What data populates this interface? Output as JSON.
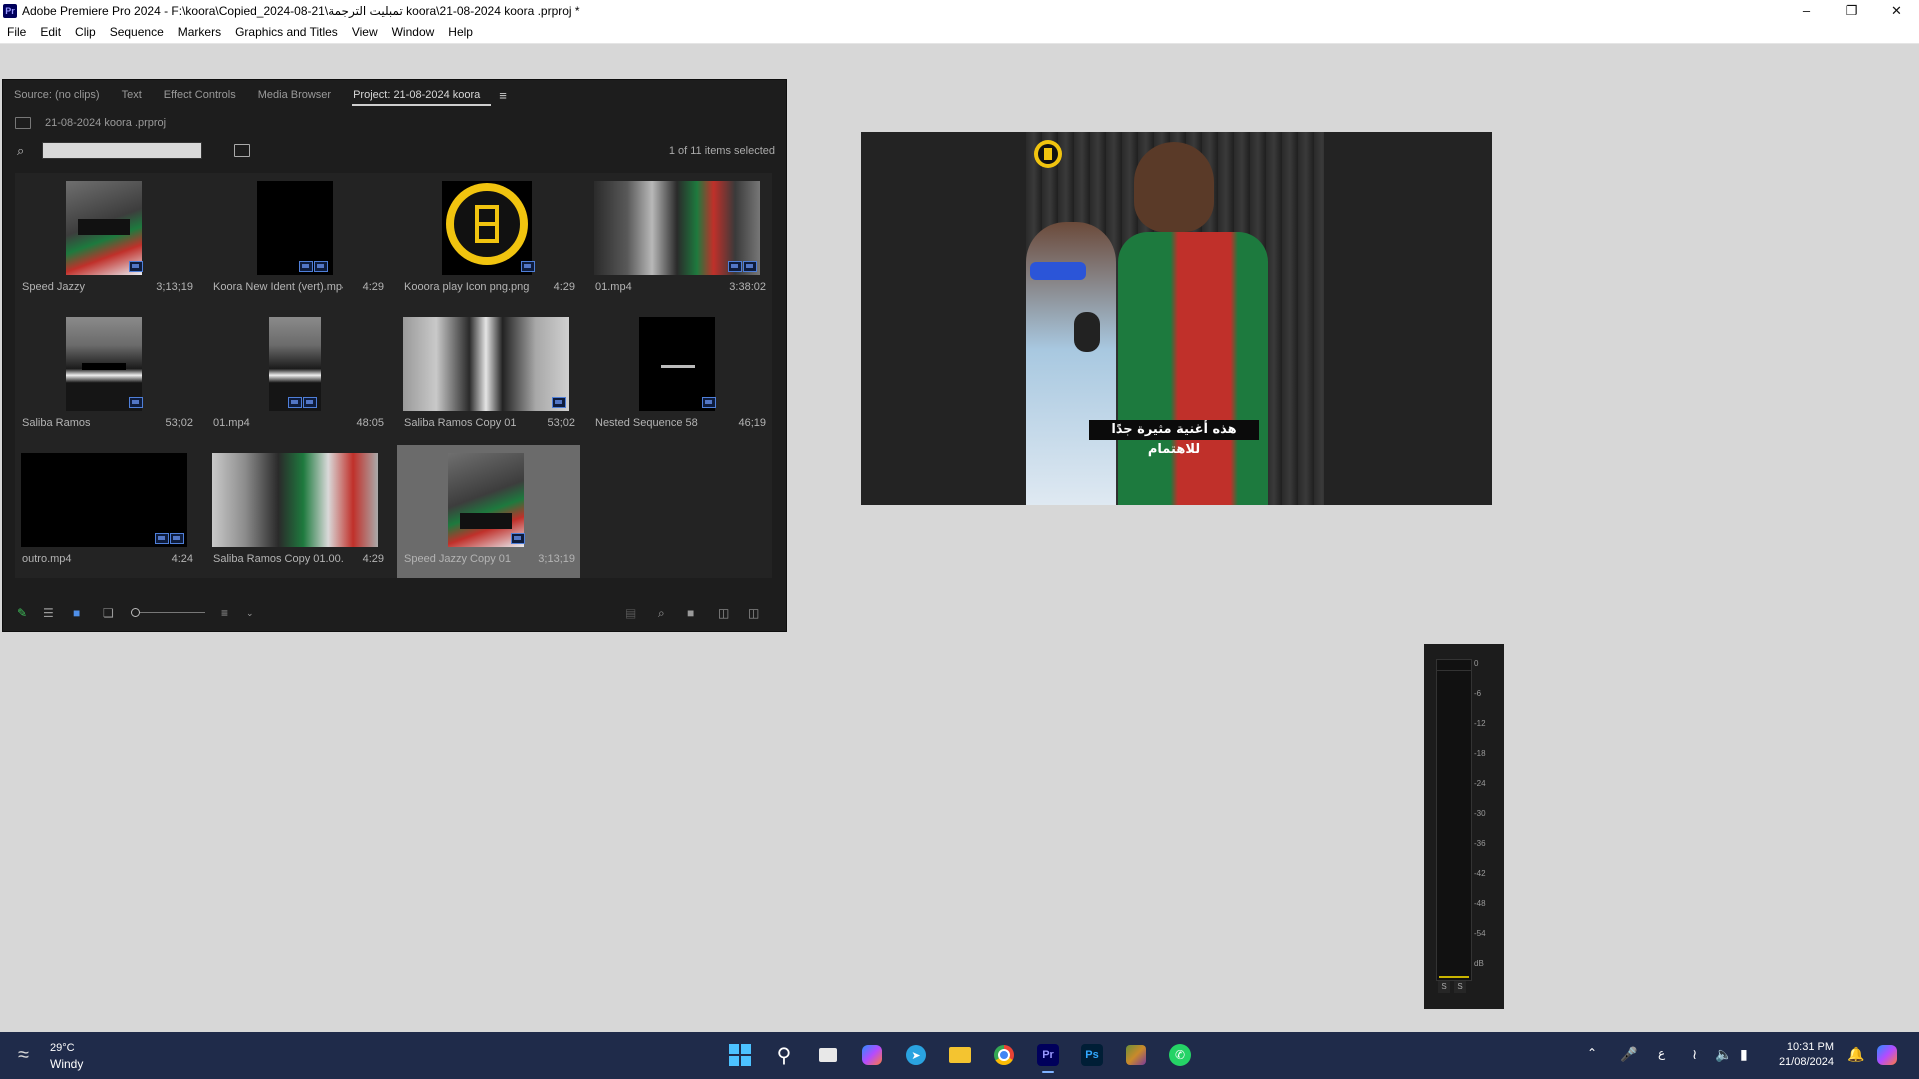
{
  "window": {
    "app_icon": "Pr",
    "title": "Adobe Premiere Pro 2024 - F:\\koora\\Copied_2024-08-21\\تمبليت الترجمة koora\\21-08-2024 koora .prproj *",
    "controls": [
      "minimize-icon",
      "maximize-icon",
      "close-icon"
    ]
  },
  "menu": [
    "File",
    "Edit",
    "Clip",
    "Sequence",
    "Markers",
    "Graphics and Titles",
    "View",
    "Window",
    "Help"
  ],
  "project_panel": {
    "tabs": [
      "Source: (no clips)",
      "Text",
      "Effect Controls",
      "Media Browser",
      "Project: 21-08-2024 koora"
    ],
    "active_tab": "Project: 21-08-2024 koora",
    "breadcrumb": "21-08-2024 koora .prproj",
    "search": {
      "placeholder": "",
      "value": ""
    },
    "selection_status": "1 of 11 items selected",
    "items": [
      {
        "name": "Speed Jazzy",
        "duration": "3;13;19",
        "thumb": "speed"
      },
      {
        "name": "Koora New Ident (vert).mp4",
        "duration": "4:29",
        "thumb": "black"
      },
      {
        "name": "Kooora play Icon png.png",
        "duration": "4:29",
        "thumb": "logo"
      },
      {
        "name": "01.mp4",
        "duration": "3:38:02",
        "thumb": "crowd"
      },
      {
        "name": "Saliba Ramos",
        "duration": "53;02",
        "thumb": "suit"
      },
      {
        "name": "01.mp4",
        "duration": "48:05",
        "thumb": "suit"
      },
      {
        "name": "Saliba Ramos Copy 01",
        "duration": "53;02",
        "thumb": "suit-blur"
      },
      {
        "name": "Nested Sequence 58",
        "duration": "46;19",
        "thumb": "black-text"
      },
      {
        "name": "outro.mp4",
        "duration": "4:24",
        "thumb": "black"
      },
      {
        "name": "Saliba Ramos Copy 01.00...",
        "duration": "4:29",
        "thumb": "suit-blur"
      },
      {
        "name": "Speed Jazzy Copy 01",
        "duration": "3;13;19",
        "thumb": "speed",
        "selected": true
      }
    ],
    "toolbar_icons": [
      "pencil-icon",
      "list-view-icon",
      "icon-view-icon",
      "freeform-view-icon",
      "zoom-slider",
      "sort-icon",
      "automate-icon",
      "find-icon",
      "new-bin-icon",
      "new-item-icon",
      "trash-icon"
    ]
  },
  "program_monitor": {
    "caption": "هذه أغنية مثيرة جدًا للاهتمام"
  },
  "audio_meter": {
    "scale": [
      "0",
      "-6",
      "-12",
      "-18",
      "-24",
      "-30",
      "-36",
      "-42",
      "-48",
      "-54",
      "dB"
    ],
    "solo_buttons": [
      "S",
      "S"
    ]
  },
  "taskbar": {
    "weather": {
      "temp": "29°C",
      "desc": "Windy"
    },
    "apps": [
      "start-icon",
      "search-icon",
      "task-view-icon",
      "copilot-icon",
      "telegram-icon",
      "file-explorer-icon",
      "chrome-icon",
      "premiere-icon",
      "photoshop-icon",
      "game-icon",
      "whatsapp-icon"
    ],
    "tray": {
      "language": "ع"
    },
    "clock": {
      "time": "10:31 PM",
      "date": "21/08/2024"
    }
  },
  "colors": {
    "panel_bg": "#1d1d1d",
    "workspace_bg": "#d7d7d7",
    "taskbar_bg": "#1f2b4a",
    "accent": "#4f7fd9"
  }
}
